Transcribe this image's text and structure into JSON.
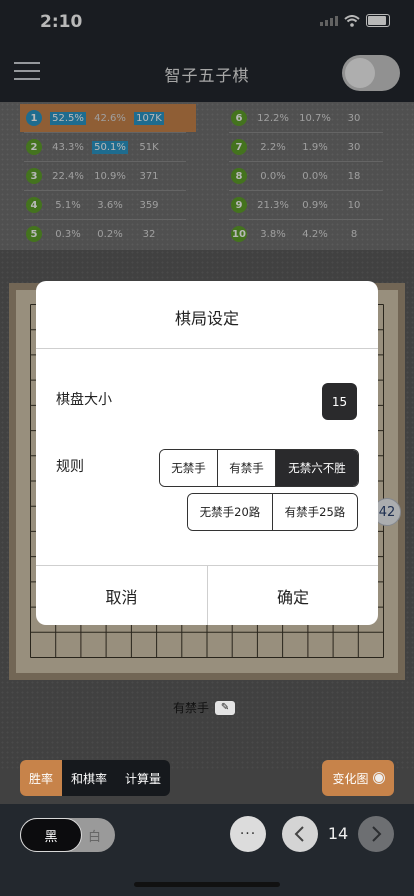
{
  "status": {
    "time": "2:10"
  },
  "header": {
    "title": "智子五子棋"
  },
  "stats": {
    "left": [
      {
        "n": "1",
        "a": "52.5%",
        "b": "42.6%",
        "c": "107K"
      },
      {
        "n": "2",
        "a": "43.3%",
        "b": "50.1%",
        "c": "51K"
      },
      {
        "n": "3",
        "a": "22.4%",
        "b": "10.9%",
        "c": "371"
      },
      {
        "n": "4",
        "a": "5.1%",
        "b": "3.6%",
        "c": "359"
      },
      {
        "n": "5",
        "a": "0.3%",
        "b": "0.2%",
        "c": "32"
      }
    ],
    "right": [
      {
        "n": "6",
        "a": "12.2%",
        "b": "10.7%",
        "c": "30"
      },
      {
        "n": "7",
        "a": "2.2%",
        "b": "1.9%",
        "c": "30"
      },
      {
        "n": "8",
        "a": "0.0%",
        "b": "0.0%",
        "c": "18"
      },
      {
        "n": "9",
        "a": "21.3%",
        "b": "0.9%",
        "c": "10"
      },
      {
        "n": "10",
        "a": "3.8%",
        "b": "4.2%",
        "c": "8"
      }
    ]
  },
  "board": {
    "stone_label": "42"
  },
  "dialog": {
    "title": "棋局设定",
    "size_label": "棋盘大小",
    "size_value": "15",
    "rule_label": "规则",
    "rules_row1": [
      "无禁手",
      "有禁手",
      "无禁六不胜"
    ],
    "rules_row2": [
      "无禁手20路",
      "有禁手25路"
    ],
    "selected_rule": "无禁六不胜",
    "cancel": "取消",
    "confirm": "确定"
  },
  "current_rule": "有禁手",
  "tabs": [
    "胜率",
    "和棋率",
    "计算量"
  ],
  "active_tab": "胜率",
  "trend_button": "变化图",
  "bottom": {
    "black": "黑",
    "white": "白",
    "more": "···",
    "move_number": "14"
  },
  "colors": {
    "accent": "#c7834a",
    "highlight": "#2a96c7",
    "rank_green": "#5fa02a",
    "bar": "#23282e"
  }
}
